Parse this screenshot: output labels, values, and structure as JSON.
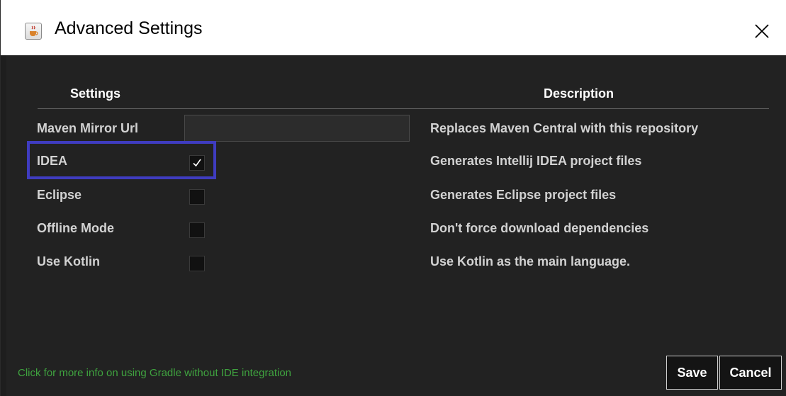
{
  "window": {
    "title": "Advanced Settings",
    "icon": "java-cup-icon",
    "close_icon": "close-icon"
  },
  "table": {
    "headers": {
      "settings": "Settings",
      "description": "Description"
    },
    "rows": [
      {
        "label": "Maven Mirror Url",
        "control": "text-input",
        "value": "",
        "description": "Replaces Maven Central with this repository"
      },
      {
        "label": "IDEA",
        "control": "checkbox",
        "checked": true,
        "description": "Generates Intellij IDEA project files"
      },
      {
        "label": "Eclipse",
        "control": "checkbox",
        "checked": false,
        "description": "Generates Eclipse project files"
      },
      {
        "label": "Offline Mode",
        "control": "checkbox",
        "checked": false,
        "description": "Don't force download dependencies"
      },
      {
        "label": "Use Kotlin",
        "control": "checkbox",
        "checked": false,
        "description": "Use Kotlin as the main language."
      }
    ]
  },
  "footer": {
    "link_text": "Click for more info on using Gradle without IDE integration",
    "save_label": "Save",
    "cancel_label": "Cancel"
  },
  "colors": {
    "background": "#222222",
    "text": "#d2d2d2",
    "link": "#3fa33f",
    "highlight": "#3f3cc0"
  }
}
